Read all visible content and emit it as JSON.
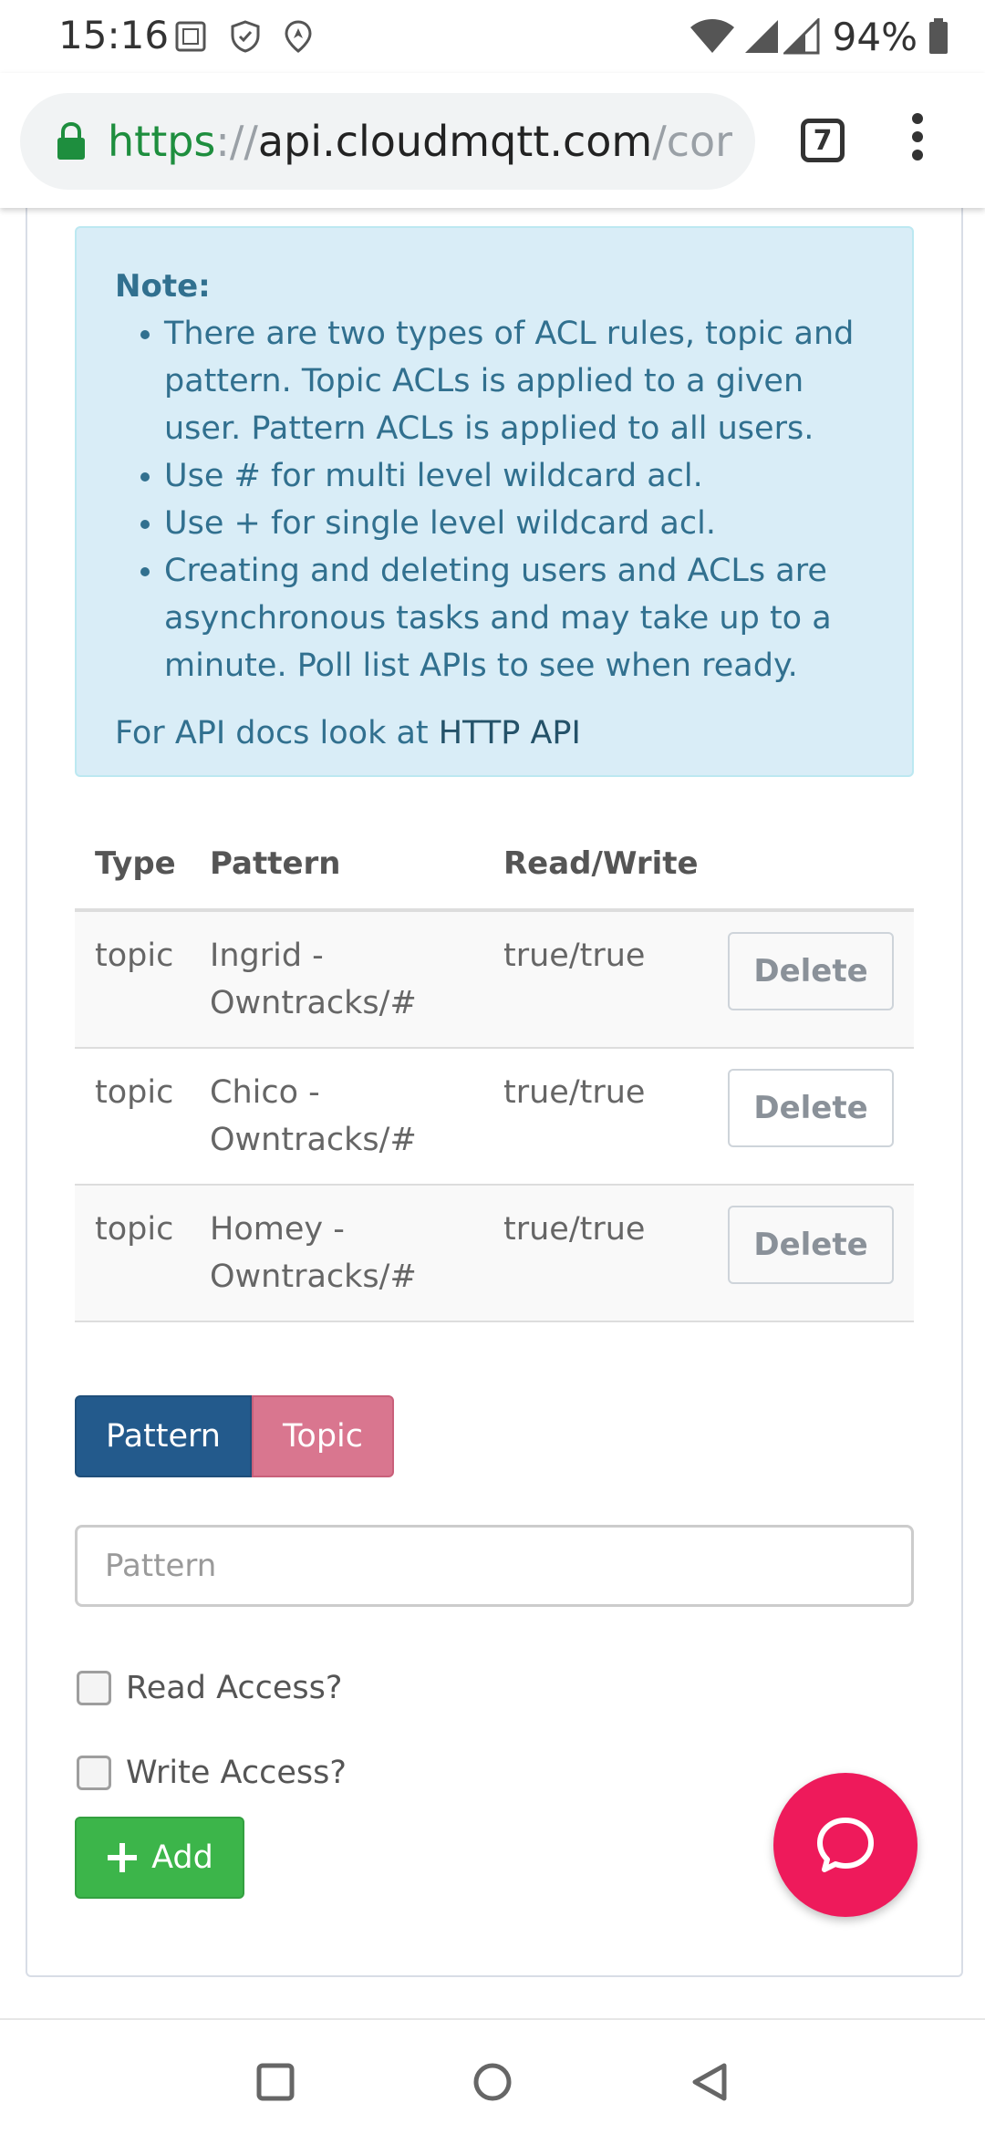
{
  "status_bar": {
    "time": "15:16",
    "battery": "94%"
  },
  "browser": {
    "url_scheme": "https",
    "url_separator": "://",
    "url_host": "api.cloudmqtt.com",
    "url_rest": "/cor",
    "tab_count": "7"
  },
  "note": {
    "title": "Note:",
    "items": [
      "There are two types of ACL rules, topic and pattern. Topic ACLs is applied to a given user. Pattern ACLs is applied to all users.",
      "Use # for multi level wildcard acl.",
      "Use + for single level wildcard acl.",
      "Creating and deleting users and ACLs are asynchronous tasks and may take up to a minute. Poll list APIs to see when ready."
    ],
    "api_prefix": "For API docs look at ",
    "api_link": "HTTP API"
  },
  "acl_table": {
    "headers": [
      "Type",
      "Pattern",
      "Read/Write",
      ""
    ],
    "rows": [
      {
        "type": "topic",
        "pattern_line1": "Ingrid -",
        "pattern_line2": "Owntracks/#",
        "rw": "true/true",
        "action": "Delete"
      },
      {
        "type": "topic",
        "pattern_line1": "Chico -",
        "pattern_line2": "Owntracks/#",
        "rw": "true/true",
        "action": "Delete"
      },
      {
        "type": "topic",
        "pattern_line1": "Homey -",
        "pattern_line2": "Owntracks/#",
        "rw": "true/true",
        "action": "Delete"
      }
    ]
  },
  "form": {
    "toggle_pattern": "Pattern",
    "toggle_topic": "Topic",
    "pattern_placeholder": "Pattern",
    "read_label": "Read Access?",
    "write_label": "Write Access?",
    "add_label": "Add"
  },
  "colors": {
    "note_bg": "#d9edf7",
    "note_text": "#31708f",
    "pattern_toggle": "#235a8c",
    "topic_toggle": "#d9768f",
    "add_button": "#3cb54a",
    "chat_fab": "#ee1a5b",
    "url_green": "#1e8e3e"
  }
}
